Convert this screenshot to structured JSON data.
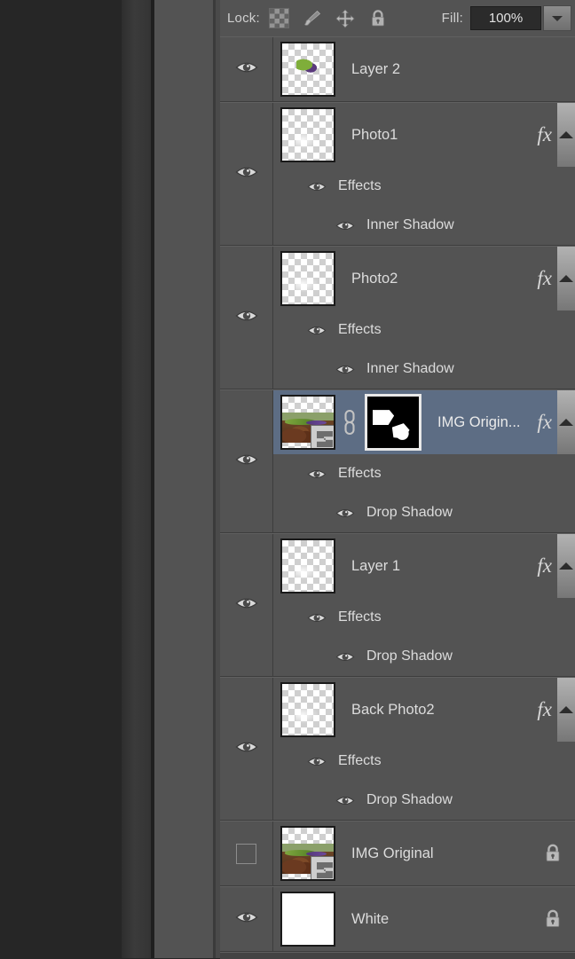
{
  "options_bar": {
    "lock_label": "Lock:",
    "lock_buttons": [
      {
        "name": "lock-transparent-pixels",
        "icon": "checkerboard-icon"
      },
      {
        "name": "lock-image-pixels",
        "icon": "brush-icon"
      },
      {
        "name": "lock-position",
        "icon": "move-arrows-icon"
      },
      {
        "name": "lock-all",
        "icon": "lock-icon"
      }
    ],
    "fill_label": "Fill:",
    "fill_value": "100%",
    "fill_dropdown_icon": "chevron-down-icon"
  },
  "colors": {
    "panel_bg": "#535353",
    "selected_row": "#5d6d84",
    "text": "#dcdcdc",
    "list_empty_bg": "#434343",
    "canvas_bg": "#262626"
  },
  "layers": [
    {
      "name": "Layer 2",
      "visible": true,
      "selected": false,
      "thumb": "transparent-with-bug",
      "has_fx": false,
      "locked": false,
      "mask": false,
      "linked": false,
      "effects": []
    },
    {
      "name": "Photo1",
      "visible": true,
      "selected": false,
      "thumb": "transparent-faint",
      "has_fx": true,
      "locked": false,
      "mask": false,
      "linked": false,
      "effects_group_label": "Effects",
      "effects": [
        "Inner Shadow"
      ]
    },
    {
      "name": "Photo2",
      "visible": true,
      "selected": false,
      "thumb": "transparent-faint",
      "has_fx": true,
      "locked": false,
      "mask": false,
      "linked": false,
      "effects_group_label": "Effects",
      "effects": [
        "Inner Shadow"
      ]
    },
    {
      "name": "IMG Origin...",
      "visible": true,
      "selected": true,
      "thumb": "photo-smart-object",
      "has_fx": true,
      "locked": false,
      "mask": true,
      "linked": true,
      "effects_group_label": "Effects",
      "effects": [
        "Drop Shadow"
      ]
    },
    {
      "name": "Layer 1",
      "visible": true,
      "selected": false,
      "thumb": "transparent-faint",
      "has_fx": true,
      "locked": false,
      "mask": false,
      "linked": false,
      "effects_group_label": "Effects",
      "effects": [
        "Drop Shadow"
      ]
    },
    {
      "name": "Back Photo2",
      "visible": true,
      "selected": false,
      "thumb": "transparent-faint",
      "has_fx": true,
      "locked": false,
      "mask": false,
      "linked": false,
      "effects_group_label": "Effects",
      "effects": [
        "Drop Shadow"
      ]
    },
    {
      "name": "IMG Original",
      "visible": false,
      "selected": false,
      "thumb": "photo-smart-object",
      "has_fx": false,
      "locked": true,
      "mask": false,
      "linked": false,
      "effects": []
    },
    {
      "name": "White",
      "visible": true,
      "selected": false,
      "thumb": "solid-white",
      "has_fx": false,
      "locked": true,
      "mask": false,
      "linked": false,
      "effects": []
    }
  ]
}
